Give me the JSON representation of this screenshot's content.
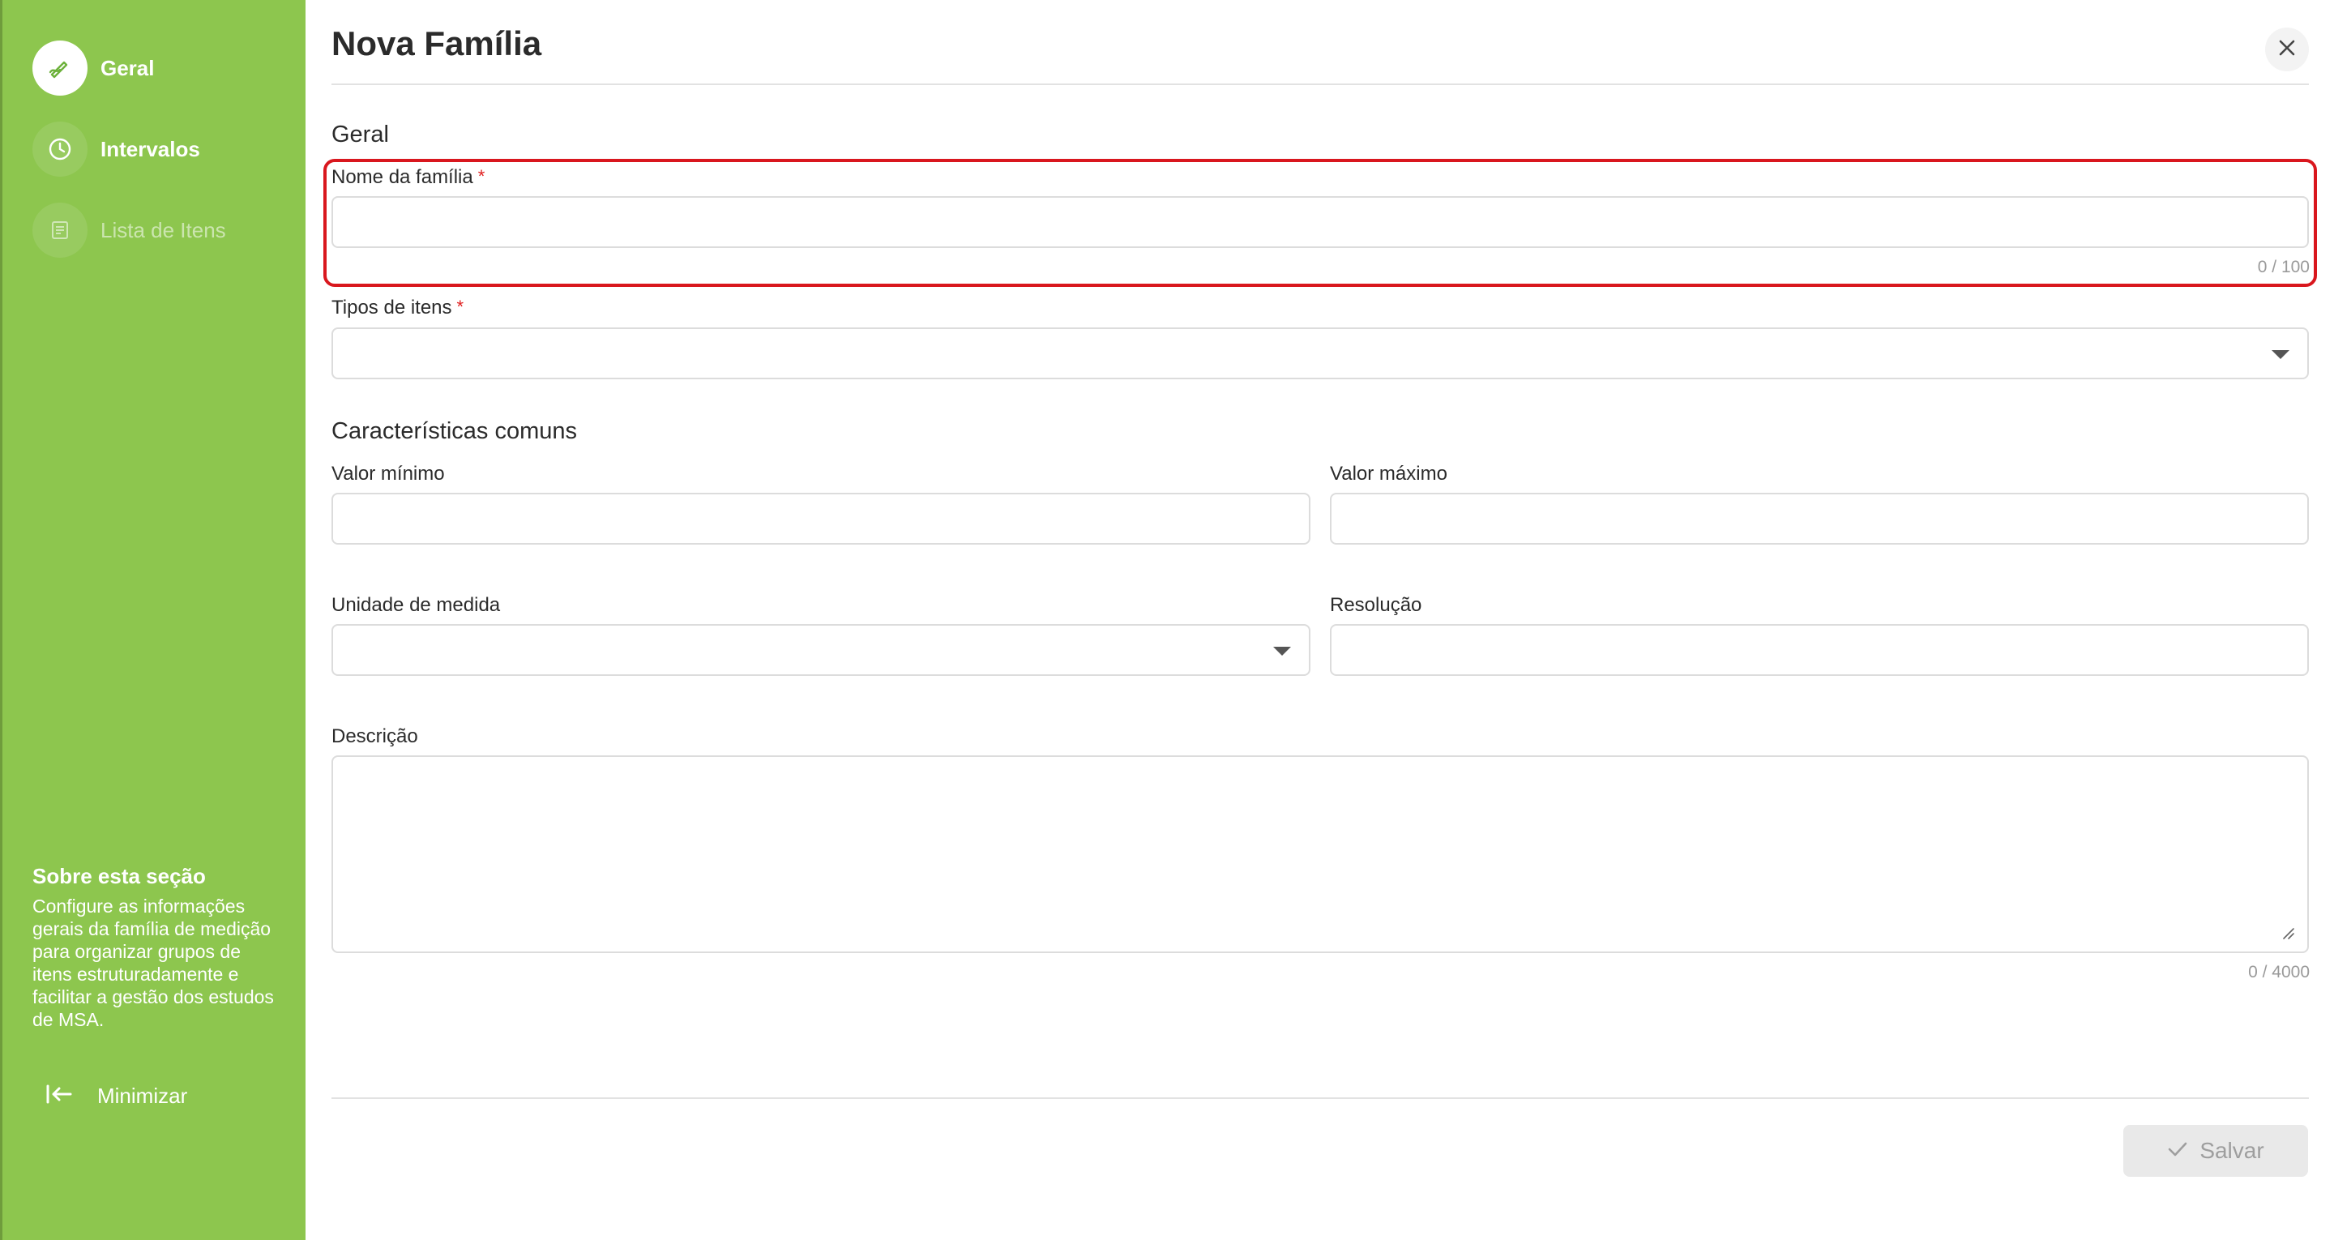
{
  "sidebar": {
    "items": [
      {
        "label": "Geral",
        "icon": "pencil-icon",
        "state": "active"
      },
      {
        "label": "Intervalos",
        "icon": "clock-icon",
        "state": "enabled"
      },
      {
        "label": "Lista de Itens",
        "icon": "list-icon",
        "state": "disabled"
      }
    ],
    "about_title": "Sobre esta seção",
    "about_text": "Configure as informações gerais da família de medição para organizar grupos de itens estruturadamente e facilitar a gestão dos estudos de MSA.",
    "minimize_label": "Minimizar"
  },
  "header": {
    "title": "Nova Família",
    "close_icon": "close-icon"
  },
  "form": {
    "section_general": "Geral",
    "family_name": {
      "label": "Nome da família",
      "required_mark": "*",
      "value": "",
      "counter": "0 / 100"
    },
    "item_types": {
      "label": "Tipos de itens",
      "required_mark": "*",
      "value": ""
    },
    "section_common": "Características comuns",
    "min_value": {
      "label": "Valor mínimo",
      "value": ""
    },
    "max_value": {
      "label": "Valor máximo",
      "value": ""
    },
    "unit": {
      "label": "Unidade de medida",
      "value": ""
    },
    "resolution": {
      "label": "Resolução",
      "value": ""
    },
    "description": {
      "label": "Descrição",
      "value": "",
      "counter": "0 / 4000"
    }
  },
  "footer": {
    "save_label": "Salvar",
    "save_icon": "check-icon",
    "save_state": "disabled"
  },
  "colors": {
    "sidebar_bg": "#8dc64e",
    "accent": "#6cb13a",
    "highlight_border": "#d9171e",
    "required": "#e02020"
  }
}
